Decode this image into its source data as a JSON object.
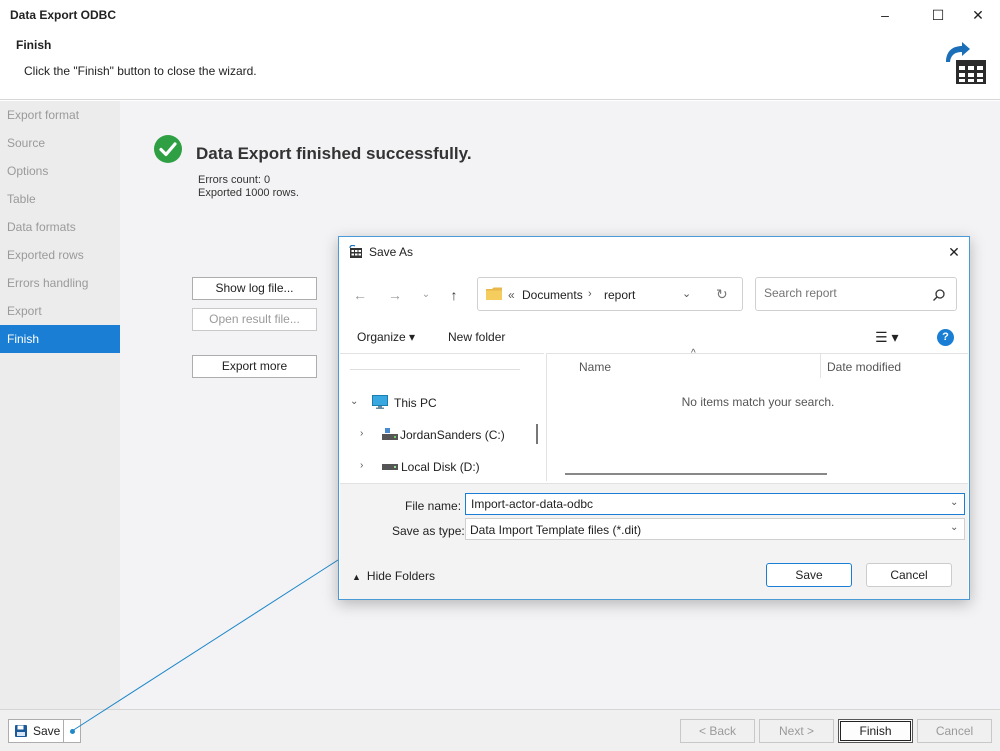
{
  "window": {
    "title": "Data Export ODBC",
    "min": "–",
    "max": "☐",
    "close": "✕"
  },
  "header": {
    "step_title": "Finish",
    "step_desc": "Click the \"Finish\" button to close the wizard."
  },
  "sidebar": {
    "items": [
      {
        "label": "Export format",
        "active": false
      },
      {
        "label": "Source",
        "active": false
      },
      {
        "label": "Options",
        "active": false
      },
      {
        "label": "Table",
        "active": false
      },
      {
        "label": "Data formats",
        "active": false
      },
      {
        "label": "Exported rows",
        "active": false
      },
      {
        "label": "Errors handling",
        "active": false
      },
      {
        "label": "Export",
        "active": false
      },
      {
        "label": "Finish",
        "active": true
      }
    ]
  },
  "main": {
    "success_title": "Data Export finished successfully.",
    "errors_count": "Errors count: 0",
    "exported_rows": "Exported 1000 rows.",
    "show_log": "Show log file...",
    "open_result": "Open result file...",
    "export_more": "Export more"
  },
  "footer": {
    "save": "Save",
    "back": "< Back",
    "next": "Next >",
    "finish": "Finish",
    "cancel": "Cancel"
  },
  "dialog": {
    "title": "Save As",
    "close": "✕",
    "nav": {
      "back": "←",
      "forward": "→",
      "recent": "⌄",
      "up": "↑"
    },
    "address": {
      "prefix": "«",
      "crumb1": "Documents",
      "sep": "›",
      "crumb2": "report",
      "drop": "⌄",
      "refresh": "↻"
    },
    "search_placeholder": "Search report",
    "toolbar": {
      "organize": "Organize ▾",
      "new_folder": "New folder",
      "view": "☰ ▾",
      "help": "?"
    },
    "tree": [
      {
        "label": "This PC",
        "arrow": "⌄",
        "icon": "monitor-icon"
      },
      {
        "label": "JordanSanders (C:)",
        "arrow": "›",
        "icon": "drive-icon"
      },
      {
        "label": "Local Disk (D:)",
        "arrow": "›",
        "icon": "disk-icon"
      }
    ],
    "list": {
      "col_name": "Name",
      "col_date": "Date modified",
      "empty": "No items match your search.",
      "caret": "^"
    },
    "file_name_label": "File name:",
    "file_name_value": "Import-actor-data-odbc",
    "save_type_label": "Save as type:",
    "save_type_value": "Data Import Template files (*.dit)",
    "dd": "⌄",
    "hide_folders": "Hide Folders",
    "hide_caret": "▲",
    "save": "Save",
    "cancel": "Cancel"
  },
  "colors": {
    "accent": "#1a7fd4",
    "success": "#2ea043",
    "callout": "#1e88c8"
  }
}
